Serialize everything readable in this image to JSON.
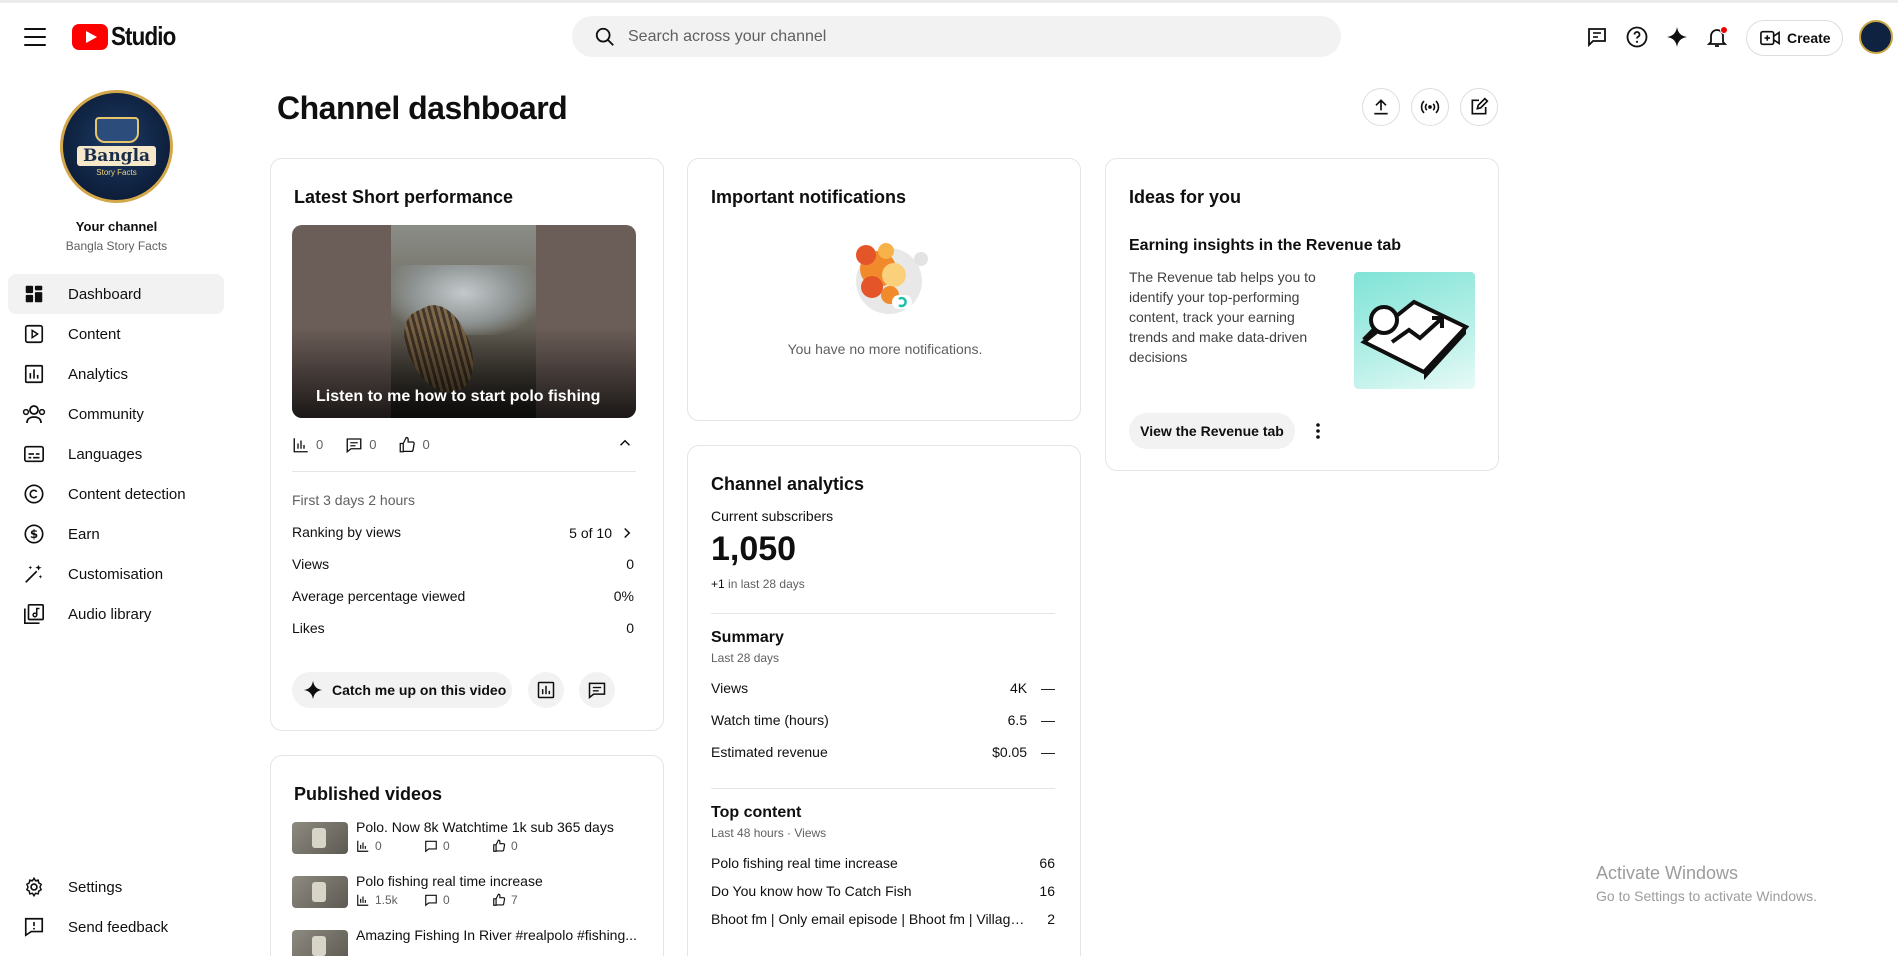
{
  "header": {
    "logo_text": "Studio",
    "search_placeholder": "Search across your channel",
    "create_label": "Create"
  },
  "sidebar": {
    "channel_title": "Your channel",
    "channel_name": "Bangla Story Facts",
    "avatar_text": "Bangla",
    "avatar_subtext": "Story Facts",
    "items": [
      {
        "label": "Dashboard",
        "icon": "dashboard-icon"
      },
      {
        "label": "Content",
        "icon": "content-icon"
      },
      {
        "label": "Analytics",
        "icon": "analytics-icon"
      },
      {
        "label": "Community",
        "icon": "community-icon"
      },
      {
        "label": "Languages",
        "icon": "languages-icon"
      },
      {
        "label": "Content detection",
        "icon": "copyright-icon"
      },
      {
        "label": "Earn",
        "icon": "earn-icon"
      },
      {
        "label": "Customisation",
        "icon": "customisation-icon"
      },
      {
        "label": "Audio library",
        "icon": "audio-library-icon"
      }
    ],
    "bottom": [
      {
        "label": "Settings",
        "icon": "gear-icon"
      },
      {
        "label": "Send feedback",
        "icon": "feedback-icon"
      }
    ]
  },
  "main": {
    "title": "Channel dashboard"
  },
  "short_perf": {
    "heading": "Latest Short performance",
    "video_title": "Listen to me how to start polo fishing",
    "views": "0",
    "comments": "0",
    "likes": "0",
    "period": "First 3 days 2 hours",
    "ranking_label": "Ranking by views",
    "ranking_value": "5 of 10",
    "rows": [
      {
        "label": "Views",
        "value": "0"
      },
      {
        "label": "Average percentage viewed",
        "value": "0%"
      },
      {
        "label": "Likes",
        "value": "0"
      }
    ],
    "catch_up_label": "Catch me up on this video"
  },
  "published": {
    "heading": "Published videos",
    "videos": [
      {
        "title": "Polo. Now 8k Watchtime 1k sub 365 days",
        "views": "0",
        "comments": "0",
        "likes": "0"
      },
      {
        "title": "Polo fishing real time increase",
        "views": "1.5k",
        "comments": "0",
        "likes": "7"
      },
      {
        "title": "Amazing Fishing In River #realpolo #fishing...",
        "views": "",
        "comments": "",
        "likes": ""
      }
    ]
  },
  "notifications": {
    "heading": "Important notifications",
    "empty_text": "You have no more notifications."
  },
  "analytics": {
    "heading": "Channel analytics",
    "subs_label": "Current subscribers",
    "subs_value": "1,050",
    "subs_delta": "+1",
    "subs_delta_period": "in last 28 days",
    "summary_heading": "Summary",
    "summary_period": "Last 28 days",
    "summary_rows": [
      {
        "label": "Views",
        "value": "4K",
        "trend": "—"
      },
      {
        "label": "Watch time (hours)",
        "value": "6.5",
        "trend": "—"
      },
      {
        "label": "Estimated revenue",
        "value": "$0.05",
        "trend": "—"
      }
    ],
    "top_heading": "Top content",
    "top_period": "Last 48 hours · Views",
    "top_rows": [
      {
        "label": "Polo fishing real time increase",
        "value": "66"
      },
      {
        "label": "Do You know how To Catch Fish",
        "value": "16"
      },
      {
        "label": "Bhoot fm | Only email episode | Bhoot fm | Village ...",
        "value": "2"
      }
    ]
  },
  "ideas": {
    "heading": "Ideas for you",
    "card_title": "Earning insights in the Revenue tab",
    "card_body": "The Revenue tab helps you to identify your top-performing content, track your earning trends and make data-driven decisions",
    "button_label": "View the Revenue tab"
  },
  "watermark": {
    "line1": "Activate Windows",
    "line2": "Go to Settings to activate Windows."
  },
  "colors": {
    "brand_red": "#ff0000",
    "accent_teal": "#7fe3d6",
    "notif_dot": "#e00000"
  }
}
